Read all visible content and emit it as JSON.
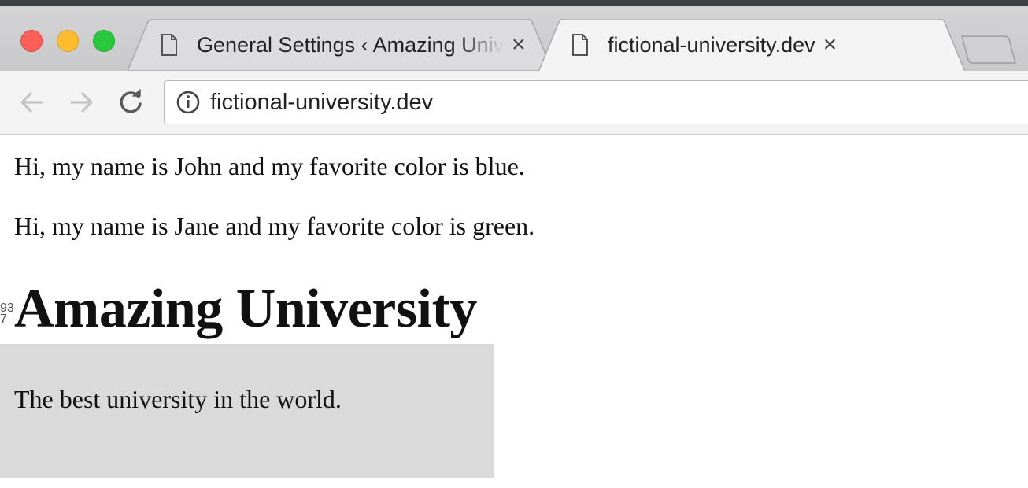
{
  "browser": {
    "tabs": [
      {
        "title": "General Settings ‹ Amazing University — WordPress",
        "close": "×",
        "active": false
      },
      {
        "title": "fictional-university.dev",
        "close": "×",
        "active": true
      }
    ],
    "address": {
      "url": "fictional-university.dev"
    },
    "icons": {
      "back": "arrow-left-icon",
      "forward": "arrow-right-icon",
      "reload": "reload-icon",
      "info": "info-icon",
      "page": "document-icon"
    },
    "colors": {
      "close": "#fb5f57",
      "minimize": "#fdbc2e",
      "maximize": "#29c83f"
    }
  },
  "page": {
    "paragraphs": [
      "Hi, my name is John and my favorite color is blue.",
      "Hi, my name is Jane and my favorite color is green."
    ],
    "site_title": "Amazing University",
    "edge_counter": [
      "93",
      "7"
    ],
    "tagline": "The best university in the world.",
    "tagline_bg": "#dadada"
  }
}
